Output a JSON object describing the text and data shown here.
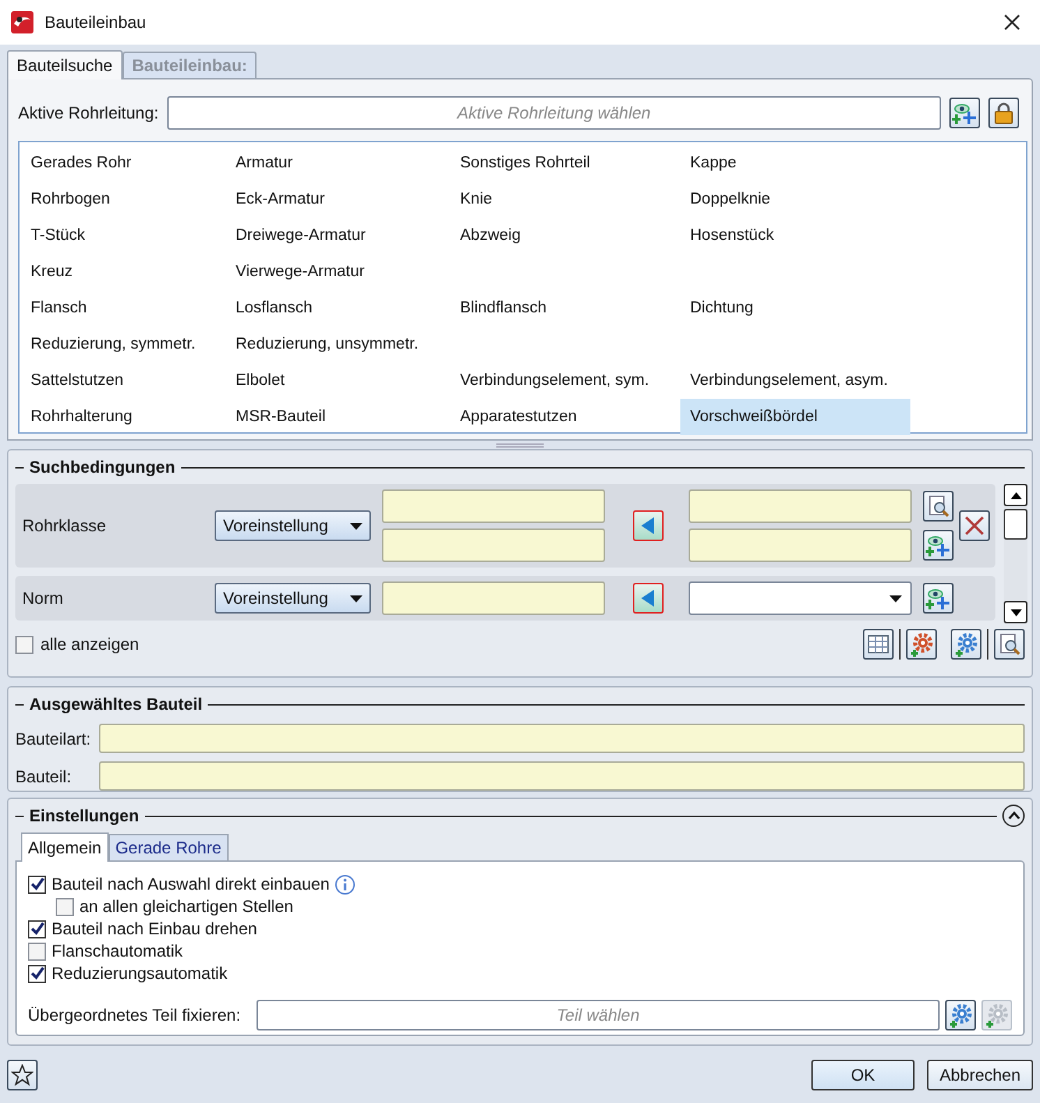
{
  "window": {
    "title": "Bauteileinbau"
  },
  "tabs": [
    {
      "label": "Bauteilsuche",
      "selected": true
    },
    {
      "label": "Bauteileinbau:",
      "selected": false
    }
  ],
  "active_pipeline": {
    "label": "Aktive Rohrleitung:",
    "placeholder": "Aktive Rohrleitung wählen"
  },
  "part_types": [
    [
      {
        "label": "Gerades Rohr",
        "selected": false
      },
      {
        "label": "Armatur",
        "selected": false
      },
      {
        "label": "Sonstiges Rohrteil",
        "selected": false
      },
      {
        "label": "Kappe",
        "selected": false
      }
    ],
    [
      {
        "label": "Rohrbogen",
        "selected": false
      },
      {
        "label": "Eck-Armatur",
        "selected": false
      },
      {
        "label": "Knie",
        "selected": false
      },
      {
        "label": "Doppelknie",
        "selected": false
      }
    ],
    [
      {
        "label": "T-Stück",
        "selected": false
      },
      {
        "label": "Dreiwege-Armatur",
        "selected": false
      },
      {
        "label": "Abzweig",
        "selected": false
      },
      {
        "label": "Hosenstück",
        "selected": false
      }
    ],
    [
      {
        "label": "Kreuz",
        "selected": false
      },
      {
        "label": "Vierwege-Armatur",
        "selected": false
      }
    ],
    [
      {
        "label": "Flansch",
        "selected": false
      },
      {
        "label": "Losflansch",
        "selected": false
      },
      {
        "label": "Blindflansch",
        "selected": false
      },
      {
        "label": "Dichtung",
        "selected": false
      }
    ],
    [
      {
        "label": "Reduzierung, symmetr.",
        "selected": false
      },
      {
        "label": "Reduzierung, unsymmetr.",
        "selected": false
      }
    ],
    [
      {
        "label": "Sattelstutzen",
        "selected": false
      },
      {
        "label": "Elbolet",
        "selected": false
      },
      {
        "label": "Verbindungselement, sym.",
        "selected": false
      },
      {
        "label": "Verbindungselement, asym.",
        "selected": false
      }
    ],
    [
      {
        "label": "Rohrhalterung",
        "selected": false
      },
      {
        "label": "MSR-Bauteil",
        "selected": false
      },
      {
        "label": "Apparatestutzen",
        "selected": false
      },
      {
        "label": "Vorschweißbördel",
        "selected": true
      }
    ]
  ],
  "search_conditions": {
    "title": "Suchbedingungen",
    "rows": [
      {
        "label": "Rohrklasse",
        "preset": "Voreinstellung",
        "kind": "range"
      },
      {
        "label": "Norm",
        "preset": "Voreinstellung",
        "kind": "single"
      }
    ],
    "show_all": {
      "label": "alle anzeigen",
      "checked": false
    }
  },
  "selected_part": {
    "title": "Ausgewähltes Bauteil",
    "fields": [
      {
        "label": "Bauteilart:"
      },
      {
        "label": "Bauteil:"
      }
    ]
  },
  "settings": {
    "title": "Einstellungen",
    "expanded": true,
    "tabs": [
      {
        "label": "Allgemein",
        "selected": true
      },
      {
        "label": "Gerade Rohre",
        "selected": false
      }
    ],
    "options": [
      {
        "label": "Bauteil nach Auswahl direkt einbauen",
        "checked": true,
        "info": true,
        "children": [
          {
            "label": "an allen gleichartigen Stellen",
            "checked": false,
            "info": false
          }
        ]
      },
      {
        "label": "Bauteil nach Einbau drehen",
        "checked": true,
        "info": false
      },
      {
        "label": "Flanschautomatik",
        "checked": false,
        "info": false
      },
      {
        "label": "Reduzierungsautomatik",
        "checked": true,
        "info": false
      }
    ],
    "fix_parent": {
      "label": "Übergeordnetes Teil fixieren:",
      "placeholder": "Teil wählen"
    }
  },
  "buttons": [
    "OK",
    "Abbrechen"
  ]
}
